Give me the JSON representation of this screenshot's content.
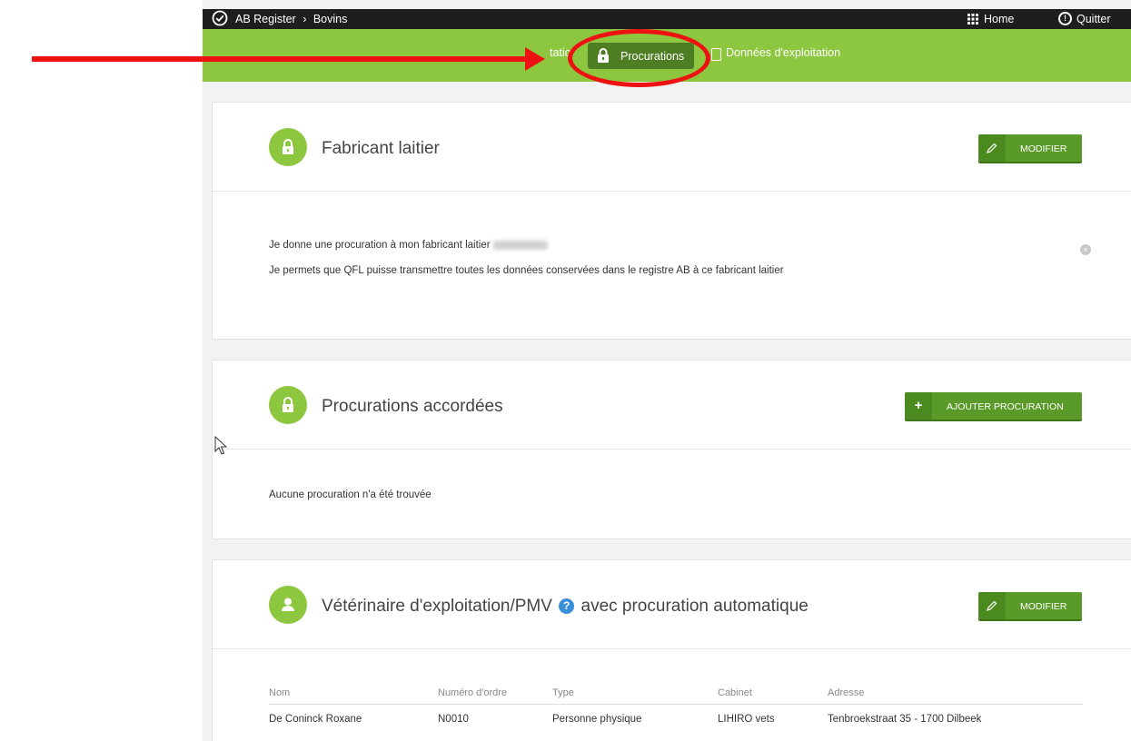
{
  "topbar": {
    "breadcrumb_root": "AB Register",
    "breadcrumb_sep": "›",
    "breadcrumb_current": "Bovins",
    "home_label": "Home",
    "quit_label": "Quitter"
  },
  "nav": {
    "item_partial": "tatio",
    "active_label": "Procurations",
    "data_label": "Données d'exploitation"
  },
  "dairy": {
    "title": "Fabricant laitier",
    "modify_label": "MODIFIER",
    "line1": "Je donne une procuration à mon fabricant laitier",
    "line2": "Je permets que QFL puisse transmettre toutes les données conservées dans le registre AB à ce fabricant laitier"
  },
  "granted": {
    "title": "Procurations accordées",
    "add_label": "AJOUTER PROCURATION",
    "empty_text": "Aucune procuration n'a été trouvée"
  },
  "vet": {
    "title_part1": "Vétérinaire d'exploitation/PMV",
    "help_glyph": "?",
    "title_part2": "avec procuration automatique",
    "modify_label": "MODIFIER",
    "columns": [
      "Nom",
      "Numéro d'ordre",
      "Type",
      "Cabinet",
      "Adresse"
    ],
    "rows": [
      [
        "De Coninck Roxane",
        "N0010",
        "Personne physique",
        "LIHIRO vets",
        "Tenbroekstraat 35 - 1700 Dilbeek"
      ]
    ]
  },
  "colors": {
    "brand_green": "#8dc63f",
    "button_green": "#5a9a28",
    "topbar": "#1e1e1e",
    "annotation_red": "#ee1111"
  }
}
